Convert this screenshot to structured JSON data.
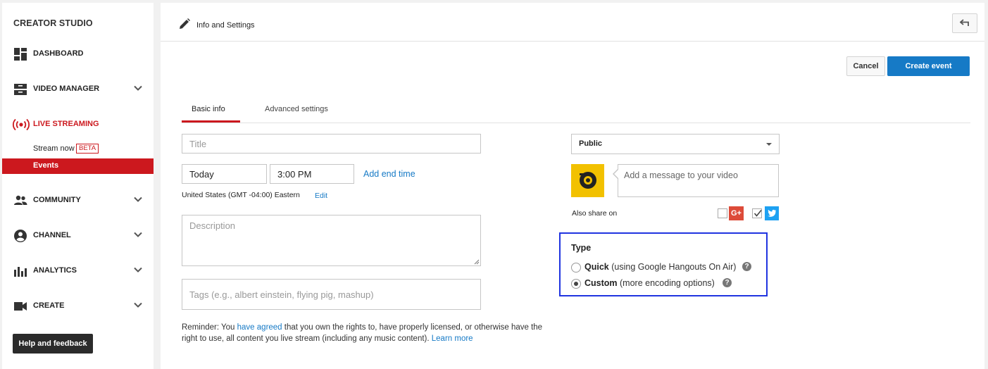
{
  "sidebar": {
    "brand": "CREATOR STUDIO",
    "items": [
      {
        "label": "DASHBOARD"
      },
      {
        "label": "VIDEO MANAGER"
      },
      {
        "label": "LIVE STREAMING"
      },
      {
        "label": "COMMUNITY"
      },
      {
        "label": "CHANNEL"
      },
      {
        "label": "ANALYTICS"
      },
      {
        "label": "CREATE"
      }
    ],
    "sub_items": [
      {
        "label": "Stream now",
        "badge": "BETA"
      },
      {
        "label": "Events"
      }
    ],
    "help_label": "Help and feedback"
  },
  "header": {
    "title": "Info and Settings"
  },
  "actions": {
    "cancel_label": "Cancel",
    "create_label": "Create event"
  },
  "tabs": [
    {
      "label": "Basic info",
      "active": true
    },
    {
      "label": "Advanced settings",
      "active": false
    }
  ],
  "form": {
    "title_placeholder": "Title",
    "date_value": "Today",
    "time_value": "3:00 PM",
    "add_end_time": "Add end time",
    "timezone": "United States (GMT -04:00) Eastern",
    "timezone_edit": "Edit",
    "description_placeholder": "Description",
    "tags_placeholder": "Tags (e.g., albert einstein, flying pig, mashup)",
    "reminder": {
      "part1": "Reminder: You ",
      "link1": "have agreed",
      "part2": " that you own the rights to, have properly licensed, or otherwise have the right to use, all content you live stream (including any music content). ",
      "link2": "Learn more"
    }
  },
  "right": {
    "privacy_value": "Public",
    "message_placeholder": "Add a message to your video",
    "share_label": "Also share on",
    "share_gplus": "G+",
    "share_gplus_checked": false,
    "share_twitter_checked": true
  },
  "type_section": {
    "title": "Type",
    "options": [
      {
        "label": "Quick",
        "detail": "(using Google Hangouts On Air)",
        "selected": false
      },
      {
        "label": "Custom",
        "detail": "(more encoding options)",
        "selected": true
      }
    ]
  },
  "colors": {
    "accent_red": "#cc181e",
    "primary_blue": "#167ac6",
    "highlight_box": "#2034e0"
  }
}
